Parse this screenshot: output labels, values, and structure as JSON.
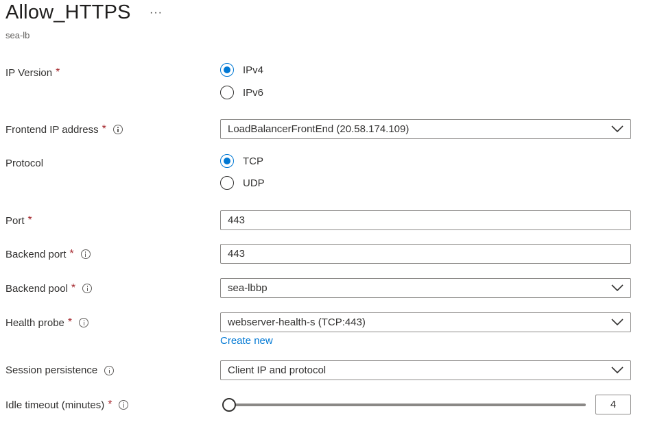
{
  "header": {
    "title": "Allow_HTTPS",
    "more": "···",
    "subtitle": "sea-lb"
  },
  "form": {
    "ip_version": {
      "label": "IP Version",
      "options": [
        "IPv4",
        "IPv6"
      ],
      "selected": "IPv4"
    },
    "frontend_ip": {
      "label": "Frontend IP address",
      "value": "LoadBalancerFrontEnd (20.58.174.109)"
    },
    "protocol": {
      "label": "Protocol",
      "options": [
        "TCP",
        "UDP"
      ],
      "selected": "TCP"
    },
    "port": {
      "label": "Port",
      "value": "443"
    },
    "backend_port": {
      "label": "Backend port",
      "value": "443"
    },
    "backend_pool": {
      "label": "Backend pool",
      "value": "sea-lbbp"
    },
    "health_probe": {
      "label": "Health probe",
      "value": "webserver-health-s (TCP:443)",
      "create_new": "Create new"
    },
    "session_persistence": {
      "label": "Session persistence",
      "value": "Client IP and protocol"
    },
    "idle_timeout": {
      "label": "Idle timeout (minutes)",
      "value": "4"
    }
  },
  "required_mark": "*",
  "colors": {
    "accent": "#0078d4",
    "required": "#a4262c",
    "text": "#323130"
  }
}
